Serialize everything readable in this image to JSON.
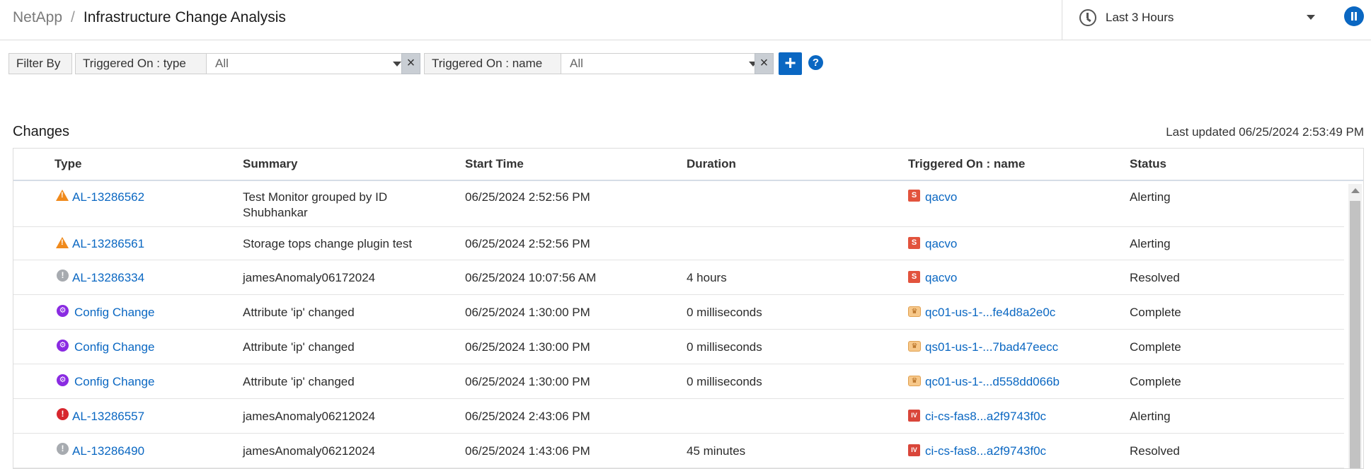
{
  "breadcrumb": {
    "root": "NetApp",
    "separator": "/",
    "title": "Infrastructure Change Analysis"
  },
  "time_range": {
    "icon": "clock-icon",
    "label": "Last 3 Hours"
  },
  "pause_icon": "pause-icon",
  "filter": {
    "label": "Filter By",
    "filters": [
      {
        "name": "Triggered On : type",
        "value": "All"
      },
      {
        "name": "Triggered On : name",
        "value": "All"
      }
    ],
    "add_label": "+",
    "help_label": "?"
  },
  "changes": {
    "title": "Changes",
    "last_updated": "Last updated 06/25/2024 2:53:49 PM",
    "columns": [
      "Type",
      "Summary",
      "Start Time",
      "Duration",
      "Triggered On : name",
      "Status"
    ],
    "rows": [
      {
        "type_icon": "warning-icon",
        "type": "AL-13286562",
        "summary": "Test Monitor grouped by ID Shubhankar",
        "start": "06/25/2024 2:52:56 PM",
        "duration": "",
        "trigger_icon": "storage-icon",
        "trigger": "qacvo",
        "status": "Alerting"
      },
      {
        "type_icon": "warning-icon",
        "type": "AL-13286561",
        "summary": "Storage tops change plugin test",
        "start": "06/25/2024 2:52:56 PM",
        "duration": "",
        "trigger_icon": "storage-icon",
        "trigger": "qacvo",
        "status": "Alerting"
      },
      {
        "type_icon": "info-grey-icon",
        "type": "AL-13286334",
        "summary": "jamesAnomaly06172024",
        "start": "06/25/2024 10:07:56 AM",
        "duration": "4 hours",
        "trigger_icon": "storage-icon",
        "trigger": "qacvo",
        "status": "Resolved"
      },
      {
        "type_icon": "config-change-icon",
        "type": "Config Change",
        "summary": "Attribute 'ip' changed",
        "start": "06/25/2024 1:30:00 PM",
        "duration": "0 milliseconds",
        "trigger_icon": "instance-icon",
        "trigger": "qc01-us-1-...fe4d8a2e0c",
        "status": "Complete"
      },
      {
        "type_icon": "config-change-icon",
        "type": "Config Change",
        "summary": "Attribute 'ip' changed",
        "start": "06/25/2024 1:30:00 PM",
        "duration": "0 milliseconds",
        "trigger_icon": "instance-icon",
        "trigger": "qs01-us-1-...7bad47eecc",
        "status": "Complete"
      },
      {
        "type_icon": "config-change-icon",
        "type": "Config Change",
        "summary": "Attribute 'ip' changed",
        "start": "06/25/2024 1:30:00 PM",
        "duration": "0 milliseconds",
        "trigger_icon": "instance-icon",
        "trigger": "qc01-us-1-...d558dd066b",
        "status": "Complete"
      },
      {
        "type_icon": "critical-icon",
        "type": "AL-13286557",
        "summary": "jamesAnomaly06212024",
        "start": "06/25/2024 2:43:06 PM",
        "duration": "",
        "trigger_icon": "internal-volume-icon",
        "trigger": "ci-cs-fas8...a2f9743f0c",
        "status": "Alerting"
      },
      {
        "type_icon": "info-grey-icon",
        "type": "AL-13286490",
        "summary": "jamesAnomaly06212024",
        "start": "06/25/2024 1:43:06 PM",
        "duration": "45 minutes",
        "trigger_icon": "internal-volume-icon",
        "trigger": "ci-cs-fas8...a2f9743f0c",
        "status": "Resolved"
      }
    ]
  }
}
